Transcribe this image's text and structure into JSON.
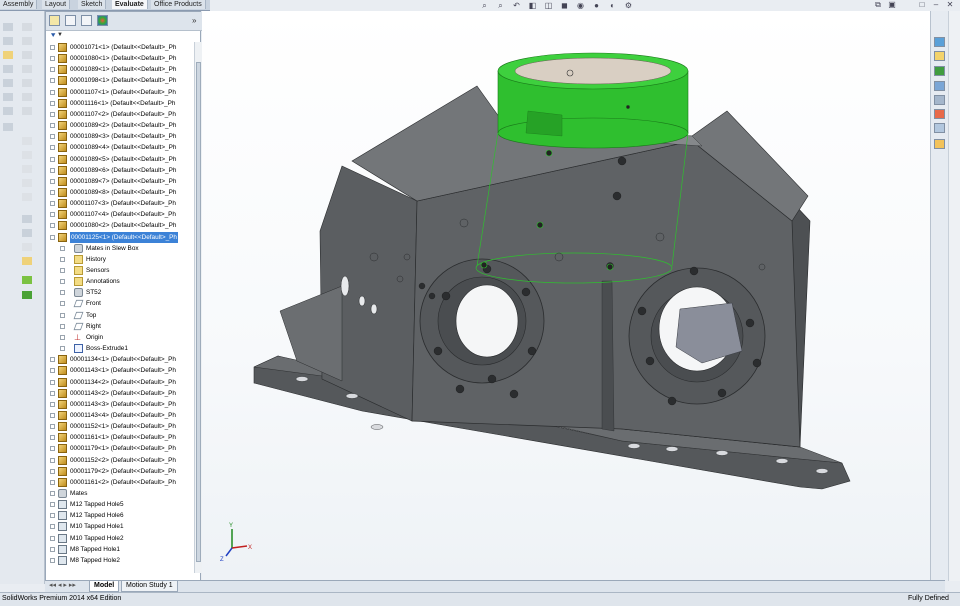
{
  "ribbon": {
    "tabs": [
      {
        "label": "Assembly",
        "active": false
      },
      {
        "label": "Layout",
        "active": false
      },
      {
        "label": "Sketch",
        "active": false
      },
      {
        "label": "Evaluate",
        "active": true
      },
      {
        "label": "Office Products",
        "active": false
      }
    ]
  },
  "heads_up_toolbar": {
    "icons": [
      "zoom-to-fit-icon",
      "zoom-area-icon",
      "previous-view-icon",
      "section-view-icon",
      "view-orientation-icon",
      "display-style-icon",
      "hide-show-icon",
      "edit-appearance-icon",
      "apply-scene-icon",
      "view-settings-icon"
    ]
  },
  "window_controls": {
    "icons": [
      "restore-icon",
      "tile-icon",
      "maximize-icon",
      "close-icon"
    ]
  },
  "panel": {
    "collapse_glyph": "»",
    "tabs": [
      "featuremanager-tab",
      "propertymanager-tab",
      "configurationmanager-tab",
      "appearance-tab"
    ],
    "filter_glyph": "▼"
  },
  "tree": [
    {
      "label": "00001071<1> (Default<<Default>_Ph",
      "kind": "part",
      "indent": 0
    },
    {
      "label": "00001080<1> (Default<<Default>_Ph",
      "kind": "part",
      "indent": 0
    },
    {
      "label": "00001089<1> (Default<<Default>_Ph",
      "kind": "part",
      "indent": 0
    },
    {
      "label": "00001098<1> (Default<<Default>_Ph",
      "kind": "part",
      "indent": 0
    },
    {
      "label": "00001107<1> (Default<<Default>_Ph",
      "kind": "part",
      "indent": 0
    },
    {
      "label": "00001116<1> (Default<<Default>_Ph",
      "kind": "part",
      "indent": 0
    },
    {
      "label": "00001107<2> (Default<<Default>_Ph",
      "kind": "part",
      "indent": 0
    },
    {
      "label": "00001089<2> (Default<<Default>_Ph",
      "kind": "part",
      "indent": 0
    },
    {
      "label": "00001089<3> (Default<<Default>_Ph",
      "kind": "part",
      "indent": 0
    },
    {
      "label": "00001089<4> (Default<<Default>_Ph",
      "kind": "part",
      "indent": 0
    },
    {
      "label": "00001089<5> (Default<<Default>_Ph",
      "kind": "part",
      "indent": 0
    },
    {
      "label": "00001089<6> (Default<<Default>_Ph",
      "kind": "part",
      "indent": 0
    },
    {
      "label": "00001089<7> (Default<<Default>_Ph",
      "kind": "part",
      "indent": 0
    },
    {
      "label": "00001089<8> (Default<<Default>_Ph",
      "kind": "part",
      "indent": 0
    },
    {
      "label": "00001107<3> (Default<<Default>_Ph",
      "kind": "part",
      "indent": 0
    },
    {
      "label": "00001107<4> (Default<<Default>_Ph",
      "kind": "part",
      "indent": 0
    },
    {
      "label": "00001080<2> (Default<<Default>_Ph",
      "kind": "part",
      "indent": 0
    },
    {
      "label": "00001125<1> (Default<<Default>_Ph",
      "kind": "part",
      "indent": 0,
      "selected": true,
      "expanded": true
    },
    {
      "label": "Mates in Slew Box",
      "kind": "mates",
      "indent": 1
    },
    {
      "label": "History",
      "kind": "folder",
      "indent": 1
    },
    {
      "label": "Sensors",
      "kind": "folder",
      "indent": 1
    },
    {
      "label": "Annotations",
      "kind": "folder",
      "indent": 1
    },
    {
      "label": "ST52",
      "kind": "mates",
      "indent": 1
    },
    {
      "label": "Front",
      "kind": "plane",
      "indent": 1
    },
    {
      "label": "Top",
      "kind": "plane",
      "indent": 1
    },
    {
      "label": "Right",
      "kind": "plane",
      "indent": 1
    },
    {
      "label": "Origin",
      "kind": "origin",
      "indent": 1
    },
    {
      "label": "Boss-Extrude1",
      "kind": "sketch",
      "indent": 1
    },
    {
      "label": "00001134<1> (Default<<Default>_Ph",
      "kind": "part",
      "indent": 0
    },
    {
      "label": "00001143<1> (Default<<Default>_Ph",
      "kind": "part",
      "indent": 0
    },
    {
      "label": "00001134<2> (Default<<Default>_Ph",
      "kind": "part",
      "indent": 0
    },
    {
      "label": "00001143<2> (Default<<Default>_Ph",
      "kind": "part",
      "indent": 0
    },
    {
      "label": "00001143<3> (Default<<Default>_Ph",
      "kind": "part",
      "indent": 0
    },
    {
      "label": "00001143<4> (Default<<Default>_Ph",
      "kind": "part",
      "indent": 0
    },
    {
      "label": "00001152<1> (Default<<Default>_Ph",
      "kind": "part",
      "indent": 0
    },
    {
      "label": "00001161<1> (Default<<Default>_Ph",
      "kind": "part",
      "indent": 0
    },
    {
      "label": "00001179<1> (Default<<Default>_Ph",
      "kind": "part",
      "indent": 0
    },
    {
      "label": "00001152<2> (Default<<Default>_Ph",
      "kind": "part",
      "indent": 0
    },
    {
      "label": "00001179<2> (Default<<Default>_Ph",
      "kind": "part",
      "indent": 0
    },
    {
      "label": "00001161<2> (Default<<Default>_Ph",
      "kind": "part",
      "indent": 0
    },
    {
      "label": "Mates",
      "kind": "mates",
      "indent": 0
    },
    {
      "label": "M12 Tapped Hole5",
      "kind": "hole",
      "indent": 0
    },
    {
      "label": "M12 Tapped Hole6",
      "kind": "hole",
      "indent": 0
    },
    {
      "label": "M10 Tapped Hole1",
      "kind": "hole",
      "indent": 0
    },
    {
      "label": "M10 Tapped Hole2",
      "kind": "hole",
      "indent": 0
    },
    {
      "label": "M8 Tapped Hole1",
      "kind": "hole",
      "indent": 0
    },
    {
      "label": "M8 Tapped Hole2",
      "kind": "hole",
      "indent": 0
    }
  ],
  "bottom_tabs": [
    {
      "label": "Model",
      "active": true
    },
    {
      "label": "Motion Study 1",
      "active": false
    }
  ],
  "status": {
    "left": "SolidWorks Premium 2014 x64 Edition",
    "right": "Fully Defined"
  },
  "triad": {
    "x": "X",
    "y": "Y",
    "z": "Z"
  },
  "colors": {
    "selection": "#3c82d7",
    "highlight_green": "#2fbf2f",
    "part_gray": "#5a5c5e"
  }
}
